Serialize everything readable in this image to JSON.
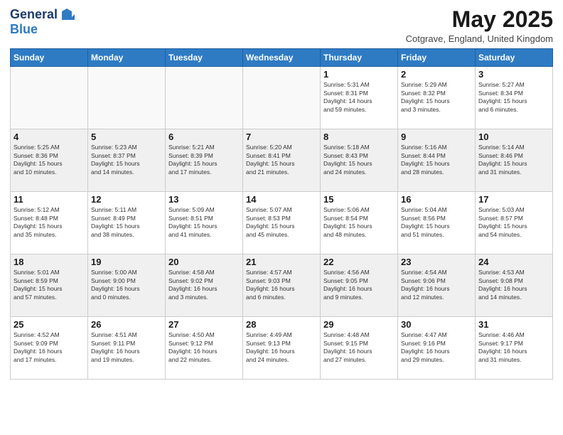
{
  "header": {
    "logo_general": "General",
    "logo_blue": "Blue",
    "month_title": "May 2025",
    "subtitle": "Cotgrave, England, United Kingdom"
  },
  "weekdays": [
    "Sunday",
    "Monday",
    "Tuesday",
    "Wednesday",
    "Thursday",
    "Friday",
    "Saturday"
  ],
  "weeks": [
    [
      {
        "day": "",
        "info": ""
      },
      {
        "day": "",
        "info": ""
      },
      {
        "day": "",
        "info": ""
      },
      {
        "day": "",
        "info": ""
      },
      {
        "day": "1",
        "info": "Sunrise: 5:31 AM\nSunset: 8:31 PM\nDaylight: 14 hours\nand 59 minutes."
      },
      {
        "day": "2",
        "info": "Sunrise: 5:29 AM\nSunset: 8:32 PM\nDaylight: 15 hours\nand 3 minutes."
      },
      {
        "day": "3",
        "info": "Sunrise: 5:27 AM\nSunset: 8:34 PM\nDaylight: 15 hours\nand 6 minutes."
      }
    ],
    [
      {
        "day": "4",
        "info": "Sunrise: 5:25 AM\nSunset: 8:36 PM\nDaylight: 15 hours\nand 10 minutes."
      },
      {
        "day": "5",
        "info": "Sunrise: 5:23 AM\nSunset: 8:37 PM\nDaylight: 15 hours\nand 14 minutes."
      },
      {
        "day": "6",
        "info": "Sunrise: 5:21 AM\nSunset: 8:39 PM\nDaylight: 15 hours\nand 17 minutes."
      },
      {
        "day": "7",
        "info": "Sunrise: 5:20 AM\nSunset: 8:41 PM\nDaylight: 15 hours\nand 21 minutes."
      },
      {
        "day": "8",
        "info": "Sunrise: 5:18 AM\nSunset: 8:43 PM\nDaylight: 15 hours\nand 24 minutes."
      },
      {
        "day": "9",
        "info": "Sunrise: 5:16 AM\nSunset: 8:44 PM\nDaylight: 15 hours\nand 28 minutes."
      },
      {
        "day": "10",
        "info": "Sunrise: 5:14 AM\nSunset: 8:46 PM\nDaylight: 15 hours\nand 31 minutes."
      }
    ],
    [
      {
        "day": "11",
        "info": "Sunrise: 5:12 AM\nSunset: 8:48 PM\nDaylight: 15 hours\nand 35 minutes."
      },
      {
        "day": "12",
        "info": "Sunrise: 5:11 AM\nSunset: 8:49 PM\nDaylight: 15 hours\nand 38 minutes."
      },
      {
        "day": "13",
        "info": "Sunrise: 5:09 AM\nSunset: 8:51 PM\nDaylight: 15 hours\nand 41 minutes."
      },
      {
        "day": "14",
        "info": "Sunrise: 5:07 AM\nSunset: 8:53 PM\nDaylight: 15 hours\nand 45 minutes."
      },
      {
        "day": "15",
        "info": "Sunrise: 5:06 AM\nSunset: 8:54 PM\nDaylight: 15 hours\nand 48 minutes."
      },
      {
        "day": "16",
        "info": "Sunrise: 5:04 AM\nSunset: 8:56 PM\nDaylight: 15 hours\nand 51 minutes."
      },
      {
        "day": "17",
        "info": "Sunrise: 5:03 AM\nSunset: 8:57 PM\nDaylight: 15 hours\nand 54 minutes."
      }
    ],
    [
      {
        "day": "18",
        "info": "Sunrise: 5:01 AM\nSunset: 8:59 PM\nDaylight: 15 hours\nand 57 minutes."
      },
      {
        "day": "19",
        "info": "Sunrise: 5:00 AM\nSunset: 9:00 PM\nDaylight: 16 hours\nand 0 minutes."
      },
      {
        "day": "20",
        "info": "Sunrise: 4:58 AM\nSunset: 9:02 PM\nDaylight: 16 hours\nand 3 minutes."
      },
      {
        "day": "21",
        "info": "Sunrise: 4:57 AM\nSunset: 9:03 PM\nDaylight: 16 hours\nand 6 minutes."
      },
      {
        "day": "22",
        "info": "Sunrise: 4:56 AM\nSunset: 9:05 PM\nDaylight: 16 hours\nand 9 minutes."
      },
      {
        "day": "23",
        "info": "Sunrise: 4:54 AM\nSunset: 9:06 PM\nDaylight: 16 hours\nand 12 minutes."
      },
      {
        "day": "24",
        "info": "Sunrise: 4:53 AM\nSunset: 9:08 PM\nDaylight: 16 hours\nand 14 minutes."
      }
    ],
    [
      {
        "day": "25",
        "info": "Sunrise: 4:52 AM\nSunset: 9:09 PM\nDaylight: 16 hours\nand 17 minutes."
      },
      {
        "day": "26",
        "info": "Sunrise: 4:51 AM\nSunset: 9:11 PM\nDaylight: 16 hours\nand 19 minutes."
      },
      {
        "day": "27",
        "info": "Sunrise: 4:50 AM\nSunset: 9:12 PM\nDaylight: 16 hours\nand 22 minutes."
      },
      {
        "day": "28",
        "info": "Sunrise: 4:49 AM\nSunset: 9:13 PM\nDaylight: 16 hours\nand 24 minutes."
      },
      {
        "day": "29",
        "info": "Sunrise: 4:48 AM\nSunset: 9:15 PM\nDaylight: 16 hours\nand 27 minutes."
      },
      {
        "day": "30",
        "info": "Sunrise: 4:47 AM\nSunset: 9:16 PM\nDaylight: 16 hours\nand 29 minutes."
      },
      {
        "day": "31",
        "info": "Sunrise: 4:46 AM\nSunset: 9:17 PM\nDaylight: 16 hours\nand 31 minutes."
      }
    ]
  ]
}
